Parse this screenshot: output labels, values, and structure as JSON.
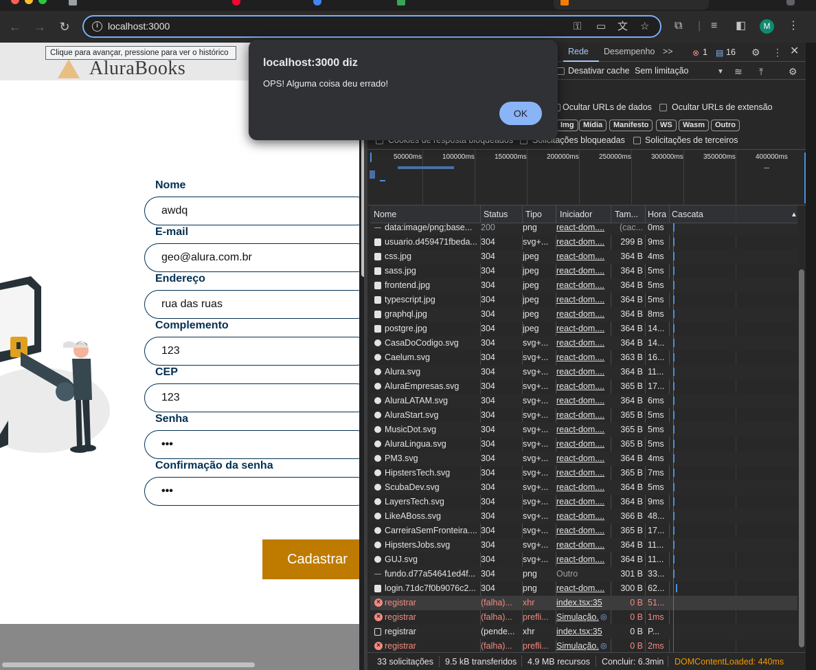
{
  "browser": {
    "url": "localhost:3000",
    "tooltip": "Clique para avançar, pressione para ver o histórico",
    "profile_initial": "M",
    "accent": "#7cacf8"
  },
  "page": {
    "logo_text": "AluraBooks",
    "form": {
      "nome_label": "Nome",
      "nome_value": "awdq",
      "email_label": "E-mail",
      "email_value": "geo@alura.com.br",
      "endereco_label": "Endereço",
      "endereco_value": "rua das ruas",
      "complemento_label": "Complemento",
      "complemento_value": "123",
      "cep_label": "CEP",
      "cep_value": "123",
      "senha_label": "Senha",
      "senha_value": "•••",
      "confirmacao_label": "Confirmação da senha",
      "confirmacao_value": "•••",
      "submit_label": "Cadastrar"
    },
    "colors": {
      "brand": "#002f52",
      "button": "#bf7b00"
    }
  },
  "alert": {
    "title": "localhost:3000 diz",
    "message": "OPS! Alguma coisa deu errado!",
    "ok_label": "OK"
  },
  "devtools": {
    "tabs": {
      "network": "Rede",
      "performance": "Desempenho",
      "more": ">>"
    },
    "errors_count": "1",
    "messages_count": "16",
    "disable_cache_label": "Desativar cache",
    "throttling_value": "Sem limitação",
    "filters": {
      "hide_data_urls": "Ocultar URLs de dados",
      "hide_extension_urls": "Ocultar URLs de extensão",
      "chips": [
        "Img",
        "Mídia",
        "Manifesto",
        "WS",
        "Wasm",
        "Outro"
      ],
      "blocked_cookies": "Cookies de resposta bloqueados",
      "blocked_requests": "Solicitações bloqueadas",
      "third_party": "Solicitações de terceiros"
    },
    "overview_ticks": [
      "50000ms",
      "100000ms",
      "150000ms",
      "200000ms",
      "250000ms",
      "300000ms",
      "350000ms",
      "400000ms"
    ],
    "columns": {
      "name": "Nome",
      "status": "Status",
      "type": "Tipo",
      "initiator": "Iniciador",
      "size": "Tam...",
      "time": "Hora",
      "waterfall": "Cascata"
    },
    "rows": [
      {
        "name": "data:image/png;base...",
        "status": "200",
        "type": "png",
        "initiator": "react-dom....",
        "size": "(cac...",
        "time": "0ms",
        "icon": "dash"
      },
      {
        "name": "usuario.d459471fbeda...",
        "status": "304",
        "type": "svg+...",
        "initiator": "react-dom....",
        "size": "299 B",
        "time": "9ms",
        "icon": "img"
      },
      {
        "name": "css.jpg",
        "status": "304",
        "type": "jpeg",
        "initiator": "react-dom....",
        "size": "364 B",
        "time": "4ms",
        "icon": "img"
      },
      {
        "name": "sass.jpg",
        "status": "304",
        "type": "jpeg",
        "initiator": "react-dom....",
        "size": "364 B",
        "time": "5ms",
        "icon": "img"
      },
      {
        "name": "frontend.jpg",
        "status": "304",
        "type": "jpeg",
        "initiator": "react-dom....",
        "size": "364 B",
        "time": "5ms",
        "icon": "img"
      },
      {
        "name": "typescript.jpg",
        "status": "304",
        "type": "jpeg",
        "initiator": "react-dom....",
        "size": "364 B",
        "time": "5ms",
        "icon": "img"
      },
      {
        "name": "graphql.jpg",
        "status": "304",
        "type": "jpeg",
        "initiator": "react-dom....",
        "size": "364 B",
        "time": "8ms",
        "icon": "img"
      },
      {
        "name": "postgre.jpg",
        "status": "304",
        "type": "jpeg",
        "initiator": "react-dom....",
        "size": "364 B",
        "time": "14...",
        "icon": "img"
      },
      {
        "name": "CasaDoCodigo.svg",
        "status": "304",
        "type": "svg+...",
        "initiator": "react-dom....",
        "size": "364 B",
        "time": "14...",
        "icon": "round"
      },
      {
        "name": "Caelum.svg",
        "status": "304",
        "type": "svg+...",
        "initiator": "react-dom....",
        "size": "363 B",
        "time": "16...",
        "icon": "round"
      },
      {
        "name": "Alura.svg",
        "status": "304",
        "type": "svg+...",
        "initiator": "react-dom....",
        "size": "364 B",
        "time": "11...",
        "icon": "round"
      },
      {
        "name": "AluraEmpresas.svg",
        "status": "304",
        "type": "svg+...",
        "initiator": "react-dom....",
        "size": "365 B",
        "time": "17...",
        "icon": "round"
      },
      {
        "name": "AluraLATAM.svg",
        "status": "304",
        "type": "svg+...",
        "initiator": "react-dom....",
        "size": "364 B",
        "time": "6ms",
        "icon": "round"
      },
      {
        "name": "AluraStart.svg",
        "status": "304",
        "type": "svg+...",
        "initiator": "react-dom....",
        "size": "365 B",
        "time": "5ms",
        "icon": "round"
      },
      {
        "name": "MusicDot.svg",
        "status": "304",
        "type": "svg+...",
        "initiator": "react-dom....",
        "size": "365 B",
        "time": "5ms",
        "icon": "round"
      },
      {
        "name": "AluraLingua.svg",
        "status": "304",
        "type": "svg+...",
        "initiator": "react-dom....",
        "size": "365 B",
        "time": "5ms",
        "icon": "round"
      },
      {
        "name": "PM3.svg",
        "status": "304",
        "type": "svg+...",
        "initiator": "react-dom....",
        "size": "364 B",
        "time": "4ms",
        "icon": "round"
      },
      {
        "name": "HipstersTech.svg",
        "status": "304",
        "type": "svg+...",
        "initiator": "react-dom....",
        "size": "365 B",
        "time": "7ms",
        "icon": "round"
      },
      {
        "name": "ScubaDev.svg",
        "status": "304",
        "type": "svg+...",
        "initiator": "react-dom....",
        "size": "364 B",
        "time": "5ms",
        "icon": "round"
      },
      {
        "name": "LayersTech.svg",
        "status": "304",
        "type": "svg+...",
        "initiator": "react-dom....",
        "size": "364 B",
        "time": "9ms",
        "icon": "round"
      },
      {
        "name": "LikeABoss.svg",
        "status": "304",
        "type": "svg+...",
        "initiator": "react-dom....",
        "size": "366 B",
        "time": "48...",
        "icon": "round"
      },
      {
        "name": "CarreiraSemFronteira....",
        "status": "304",
        "type": "svg+...",
        "initiator": "react-dom....",
        "size": "365 B",
        "time": "17...",
        "icon": "round"
      },
      {
        "name": "HipstersJobs.svg",
        "status": "304",
        "type": "svg+...",
        "initiator": "react-dom....",
        "size": "364 B",
        "time": "11...",
        "icon": "round"
      },
      {
        "name": "GUJ.svg",
        "status": "304",
        "type": "svg+...",
        "initiator": "react-dom....",
        "size": "364 B",
        "time": "11...",
        "icon": "round"
      },
      {
        "name": "fundo.d77a54641ed4f...",
        "status": "304",
        "type": "png",
        "initiator": "Outro",
        "size": "301 B",
        "time": "33...",
        "icon": "dash"
      },
      {
        "name": "login.71dc7f0b9076c2...",
        "status": "304",
        "type": "png",
        "initiator": "react-dom....",
        "size": "300 B",
        "time": "62...",
        "icon": "img"
      },
      {
        "name": "registrar",
        "status": "(falha)...",
        "type": "xhr",
        "initiator": "index.tsx:35",
        "size": "0 B",
        "time": "51...",
        "icon": "err"
      },
      {
        "name": "registrar",
        "status": "(falha)...",
        "type": "prefli...",
        "initiator": "Simulação.",
        "size": "0 B",
        "time": "1ms",
        "icon": "err"
      },
      {
        "name": "registrar",
        "status": "(pende...",
        "type": "xhr",
        "initiator": "index.tsx:35",
        "size": "0 B",
        "time": "P...",
        "icon": "doc"
      },
      {
        "name": "registrar",
        "status": "(falha)...",
        "type": "prefli...",
        "initiator": "Simulação.",
        "size": "0 B",
        "time": "2ms",
        "icon": "err"
      }
    ],
    "status_bar": {
      "requests": "33 solicitações",
      "transferred": "9.5 kB transferidos",
      "resources": "4.9 MB recursos",
      "finish": "Concluir: 6.3min",
      "dom_loaded": "DOMContentLoaded: 440ms"
    },
    "colors": {
      "error": "#f28b82",
      "dom_loaded": "#f29900",
      "active_tab": "#a8c7fa"
    }
  }
}
